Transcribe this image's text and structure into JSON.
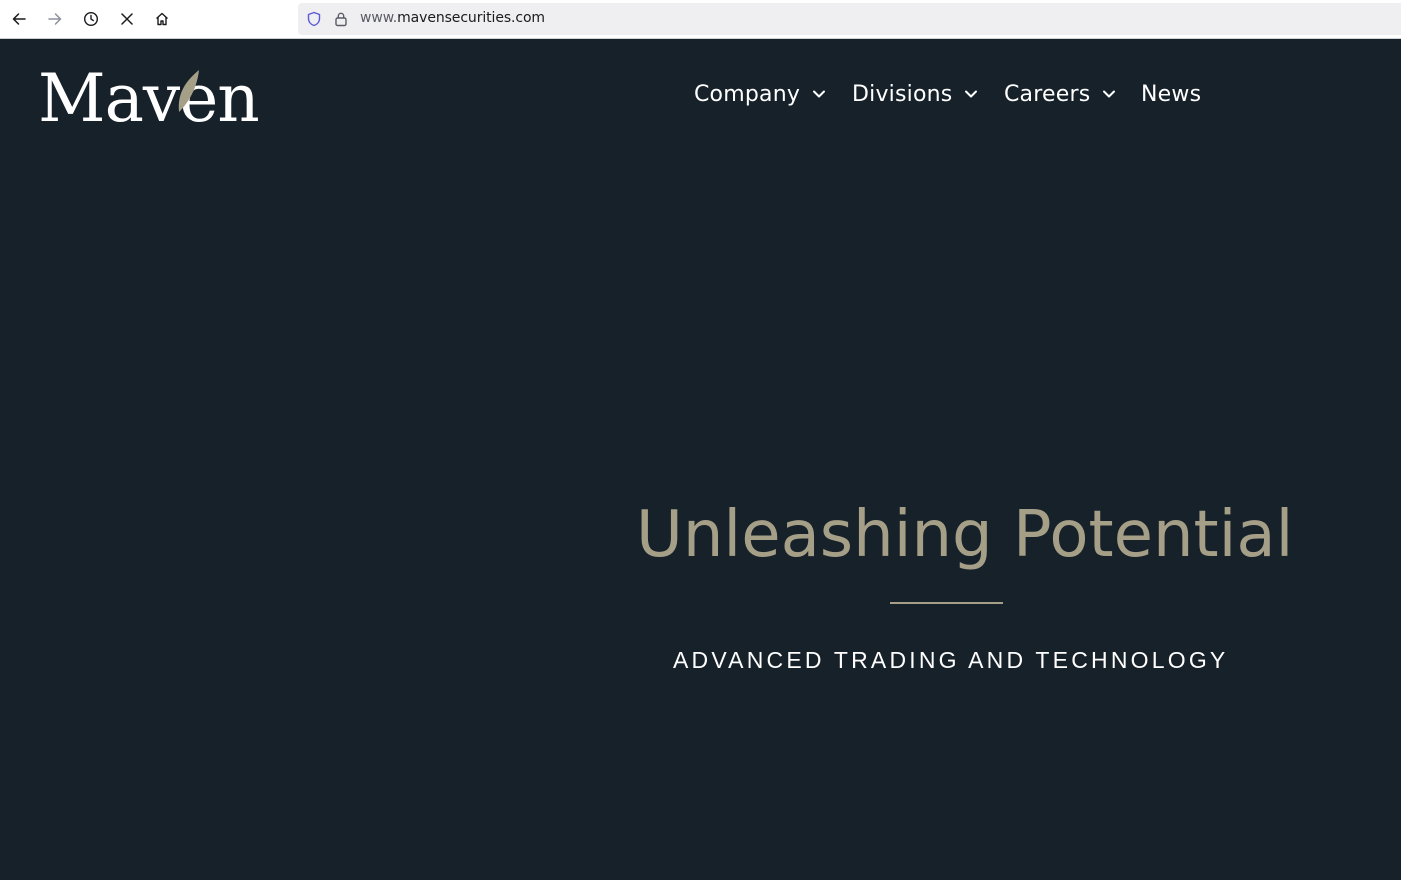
{
  "browser": {
    "url_prefix": "www.",
    "url_domain": "mavensecurities.com"
  },
  "site": {
    "logo_text": "Maven",
    "nav": [
      {
        "label": "Company",
        "has_dropdown": true
      },
      {
        "label": "Divisions",
        "has_dropdown": true
      },
      {
        "label": "Careers",
        "has_dropdown": true
      },
      {
        "label": "News",
        "has_dropdown": false
      }
    ]
  },
  "hero": {
    "title": "Unleashing Potential",
    "subtitle": "ADVANCED TRADING AND TECHNOLOGY"
  },
  "colors": {
    "page_bg": "#17212a",
    "accent_gold": "#a59f87",
    "text_white": "#ffffff"
  }
}
